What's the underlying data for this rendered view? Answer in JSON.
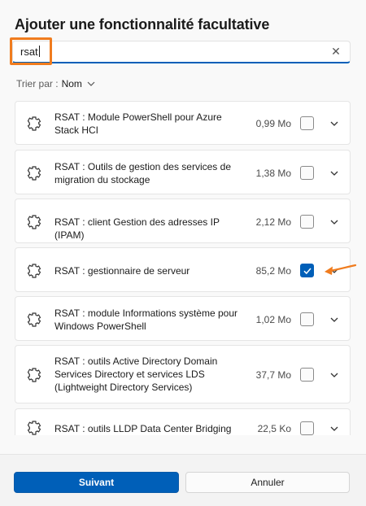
{
  "dialog": {
    "title": "Ajouter une fonctionnalité facultative"
  },
  "search": {
    "value": "rsat",
    "clear_icon": "close-icon"
  },
  "sort": {
    "label": "Trier par :",
    "value": "Nom"
  },
  "items": [
    {
      "label": "RSAT : Module PowerShell pour Azure Stack HCI",
      "size": "0,99 Mo",
      "checked": false
    },
    {
      "label": "RSAT : Outils de gestion des services de migration du stockage",
      "size": "1,38 Mo",
      "checked": false
    },
    {
      "label": "RSAT : client Gestion des adresses IP (IPAM)",
      "size": "2,12 Mo",
      "checked": false
    },
    {
      "label": "RSAT : gestionnaire de serveur",
      "size": "85,2 Mo",
      "checked": true
    },
    {
      "label": "RSAT : module Informations système pour Windows PowerShell",
      "size": "1,02 Mo",
      "checked": false
    },
    {
      "label": "RSAT : outils Active Directory Domain Services Directory et services LDS (Lightweight Directory Services)",
      "size": "37,7 Mo",
      "checked": false
    },
    {
      "label": "RSAT : outils LLDP Data Center Bridging",
      "size": "22,5 Ko",
      "checked": false
    }
  ],
  "buttons": {
    "next": "Suivant",
    "cancel": "Annuler"
  },
  "colors": {
    "accent": "#005fb8",
    "annotation": "#f07c1e"
  },
  "icons": {
    "item": "puzzle-gear-icon",
    "expand": "chevron-down-icon"
  }
}
